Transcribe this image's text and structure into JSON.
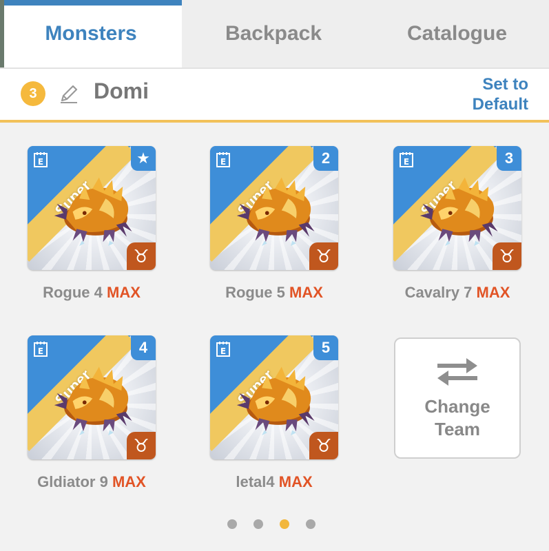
{
  "tabs": [
    {
      "label": "Monsters",
      "active": true
    },
    {
      "label": "Backpack",
      "active": false
    },
    {
      "label": "Catalogue",
      "active": false
    }
  ],
  "team": {
    "number": "3",
    "name": "Domi",
    "set_default_line1": "Set to",
    "set_default_line2": "Default"
  },
  "monsters": [
    {
      "rarity": "Super",
      "slot_badge": "★",
      "zodiac": "♉",
      "name": "Rogue 4",
      "level": "MAX"
    },
    {
      "rarity": "Super",
      "slot_badge": "2",
      "zodiac": "♉",
      "name": "Rogue 5",
      "level": "MAX"
    },
    {
      "rarity": "Super",
      "slot_badge": "3",
      "zodiac": "♉",
      "name": "Cavalry 7",
      "level": "MAX"
    },
    {
      "rarity": "Super",
      "slot_badge": "4",
      "zodiac": "♉",
      "name": "Gldiator 9",
      "level": "MAX"
    },
    {
      "rarity": "Super",
      "slot_badge": "5",
      "zodiac": "♉",
      "name": "letal4",
      "level": "MAX"
    }
  ],
  "change_team": {
    "line1": "Change",
    "line2": "Team",
    "icon": "swap-arrows-icon"
  },
  "pager": {
    "pages": 4,
    "current": 3
  },
  "colors": {
    "accent_blue": "#3e83be",
    "gold": "#f2c15a",
    "max_red": "#e15426",
    "zodiac_orange": "#c0571e"
  }
}
